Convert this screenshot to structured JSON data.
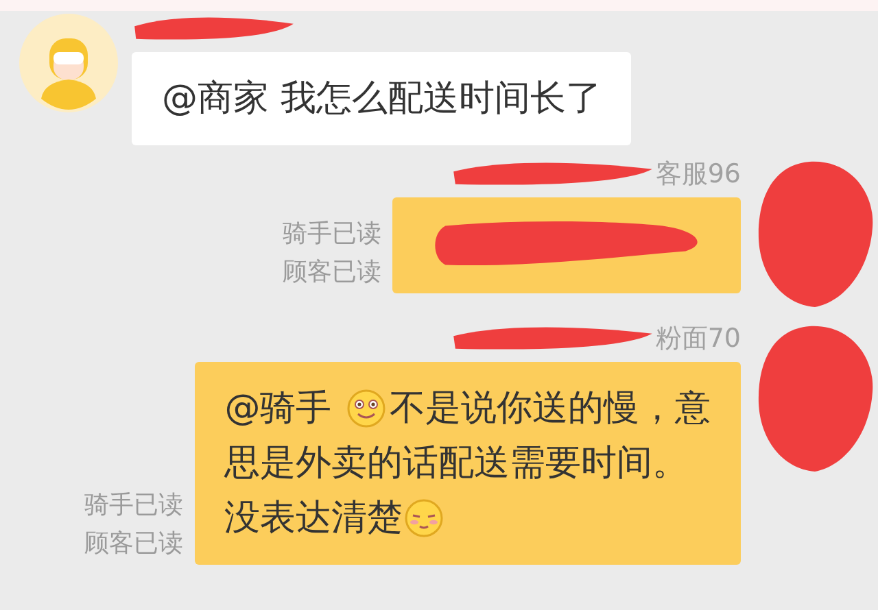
{
  "messages": [
    {
      "mine": false,
      "avatar": {
        "kind": "courier"
      },
      "sender": {
        "redacted": true
      },
      "body": {
        "kind": "text",
        "lines": [
          [
            {
              "kind": "text",
              "text": "@商家 我怎么配送时间长了"
            }
          ]
        ]
      }
    },
    {
      "mine": true,
      "avatar": {
        "kind": "redacted"
      },
      "sender": {
        "text": "客服96",
        "redacted": true
      },
      "receipts": [
        "骑手已读",
        "顾客已读"
      ],
      "body": {
        "kind": "redacted"
      }
    },
    {
      "mine": true,
      "avatar": {
        "kind": "redacted"
      },
      "sender": {
        "text": "粉面70",
        "redacted": true
      },
      "receipts": [
        "骑手已读",
        "顾客已读"
      ],
      "body": {
        "kind": "text",
        "lines": [
          [
            {
              "kind": "text",
              "text": "@骑手 "
            },
            {
              "kind": "smile"
            },
            {
              "kind": "text",
              "text": "不是说你送的慢，意"
            }
          ],
          [
            {
              "kind": "text",
              "text": "思是外卖的话配送需要时间。"
            }
          ],
          [
            {
              "kind": "text",
              "text": "没表达清楚"
            },
            {
              "kind": "blush"
            }
          ]
        ]
      }
    }
  ]
}
